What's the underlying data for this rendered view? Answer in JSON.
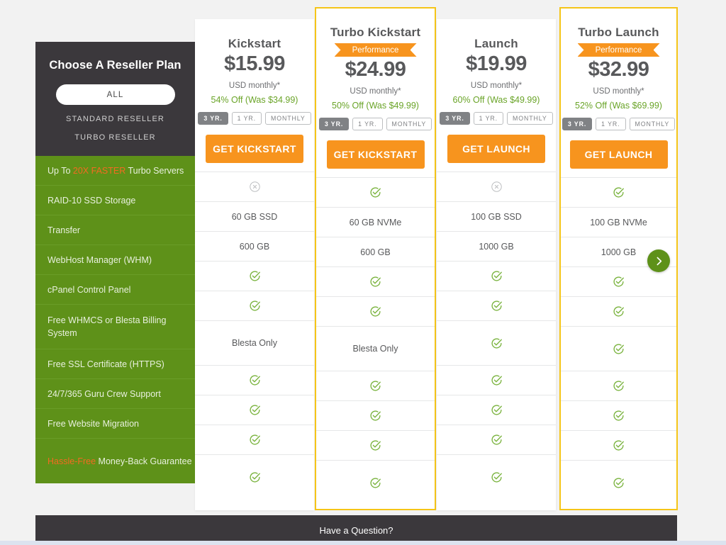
{
  "sidebar": {
    "title": "Choose A Reseller Plan",
    "filters": [
      {
        "label": "ALL",
        "active": true
      },
      {
        "label": "STANDARD RESELLER",
        "active": false
      },
      {
        "label": "TURBO RESELLER",
        "active": false
      }
    ],
    "features": [
      {
        "pre": "Up To ",
        "hl": "20X FASTER",
        "post": " Turbo Servers",
        "tall": false
      },
      {
        "pre": "RAID-10 SSD Storage",
        "hl": "",
        "post": "",
        "tall": false
      },
      {
        "pre": "Transfer",
        "hl": "",
        "post": "",
        "tall": false
      },
      {
        "pre": "WebHost Manager (WHM)",
        "hl": "",
        "post": "",
        "tall": false
      },
      {
        "pre": "cPanel Control Panel",
        "hl": "",
        "post": "",
        "tall": false
      },
      {
        "pre": "Free WHMCS or Blesta Billing System",
        "hl": "",
        "post": "",
        "tall": true
      },
      {
        "pre": "Free SSL Certificate (HTTPS)",
        "hl": "",
        "post": "",
        "tall": false
      },
      {
        "pre": "24/7/365 Guru Crew Support",
        "hl": "",
        "post": "",
        "tall": false
      },
      {
        "pre": "Free Website Migration",
        "hl": "",
        "post": "",
        "tall": false
      },
      {
        "pre": "",
        "hl": "Hassle-Free",
        "post": " Money-Back Guarantee",
        "tall": true
      }
    ]
  },
  "plans": [
    {
      "name": "Kickstart",
      "badge": "",
      "price": "$15.99",
      "period": "USD monthly*",
      "discount": "54% Off (Was $34.99)",
      "terms": [
        "3 YR.",
        "1 YR.",
        "MONTHLY"
      ],
      "active_term": "3 YR.",
      "cta": "GET KICKSTART",
      "highlighted": false,
      "cells": [
        "x",
        "60 GB SSD",
        "600 GB",
        "check",
        "check",
        "Blesta Only",
        "check",
        "check",
        "check",
        "check"
      ]
    },
    {
      "name": "Turbo Kickstart",
      "badge": "Performance",
      "price": "$24.99",
      "period": "USD monthly*",
      "discount": "50% Off (Was $49.99)",
      "terms": [
        "3 YR.",
        "1 YR.",
        "MONTHLY"
      ],
      "active_term": "3 YR.",
      "cta": "GET KICKSTART",
      "highlighted": true,
      "cells": [
        "check",
        "60 GB NVMe",
        "600 GB",
        "check",
        "check",
        "Blesta Only",
        "check",
        "check",
        "check",
        "check"
      ]
    },
    {
      "name": "Launch",
      "badge": "",
      "price": "$19.99",
      "period": "USD monthly*",
      "discount": "60% Off (Was $49.99)",
      "terms": [
        "3 YR.",
        "1 YR.",
        "MONTHLY"
      ],
      "active_term": "3 YR.",
      "cta": "GET LAUNCH",
      "highlighted": false,
      "cells": [
        "x",
        "100 GB SSD",
        "1000 GB",
        "check",
        "check",
        "check",
        "check",
        "check",
        "check",
        "check"
      ]
    },
    {
      "name": "Turbo Launch",
      "badge": "Performance",
      "price": "$32.99",
      "period": "USD monthly*",
      "discount": "52% Off (Was $69.99)",
      "terms": [
        "3 YR.",
        "1 YR.",
        "MONTHLY"
      ],
      "active_term": "3 YR.",
      "cta": "GET LAUNCH",
      "highlighted": true,
      "cells": [
        "check",
        "100 GB NVMe",
        "1000 GB",
        "check",
        "check",
        "check",
        "check",
        "check",
        "check",
        "check"
      ]
    }
  ],
  "nav": {
    "next_icon": "chevron-right-icon"
  },
  "footer": {
    "label": "Have a Question?"
  },
  "colors": {
    "green": "#5e9119",
    "orange": "#f7941e",
    "orange_text": "#f26b21",
    "dark": "#3b383c",
    "highlight_border": "#f5c518",
    "check_green": "#7ab33e",
    "x_gray": "#bcbec0",
    "page_bg": "#f2f2f2"
  }
}
